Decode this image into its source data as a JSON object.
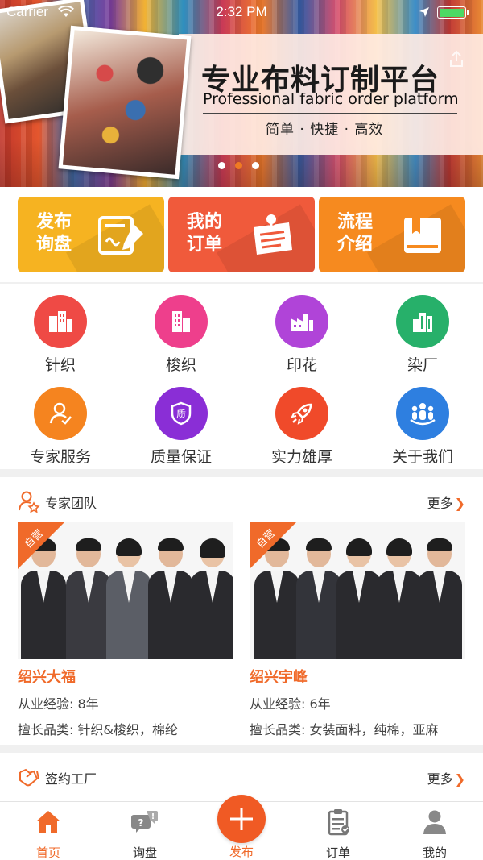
{
  "status_bar": {
    "carrier": "Carrier",
    "time": "2:32 PM",
    "battery_level": 1.0
  },
  "banner": {
    "title": "专业布料订制平台",
    "subtitle_en": "Professional fabric order platform",
    "tagline": "简单 · 快捷 · 高效",
    "slide_count": 3,
    "active_slide": 1
  },
  "quick_actions": [
    {
      "line1": "发布",
      "line2": "询盘",
      "icon": "edit-form-icon",
      "color": "#f6b321"
    },
    {
      "line1": "我的",
      "line2": "订单",
      "icon": "pinned-note-icon",
      "color": "#f05a3b"
    },
    {
      "line1": "流程",
      "line2": "介绍",
      "icon": "book-icon",
      "color": "#f68a1f"
    }
  ],
  "categories": [
    {
      "label": "针织",
      "icon": "buildings-icon",
      "color": "#ef4a45"
    },
    {
      "label": "梭织",
      "icon": "office-building-icon",
      "color": "#ee3f8c"
    },
    {
      "label": "印花",
      "icon": "factory-icon",
      "color": "#b044d8"
    },
    {
      "label": "染厂",
      "icon": "city-icon",
      "color": "#27b06a"
    },
    {
      "label": "专家服务",
      "icon": "user-check-icon",
      "color": "#f5841f"
    },
    {
      "label": "质量保证",
      "icon": "quality-icon",
      "color": "#8a2ed6"
    },
    {
      "label": "实力雄厚",
      "icon": "rocket-icon",
      "color": "#f04a2a"
    },
    {
      "label": "关于我们",
      "icon": "team-icon",
      "color": "#2e7fe0"
    }
  ],
  "expert_team": {
    "title": "专家团队",
    "more": "更多",
    "experts": [
      {
        "badge": "自营",
        "name": "绍兴大福",
        "experience_label": "从业经验:",
        "experience": "8年",
        "category_label": "擅长品类:",
        "categories": "针织&梭织，棉纶"
      },
      {
        "badge": "自营",
        "name": "绍兴宇峰",
        "experience_label": "从业经验:",
        "experience": "6年",
        "category_label": "擅长品类:",
        "categories": "女装面料，纯棉，亚麻"
      }
    ]
  },
  "signed_factory": {
    "title": "签约工厂",
    "more": "更多"
  },
  "tab_bar": {
    "tabs": [
      {
        "label": "首页",
        "icon": "home-icon",
        "active": true
      },
      {
        "label": "询盘",
        "icon": "inquiry-bubble-icon",
        "active": false
      },
      {
        "label": "发布",
        "icon": "plus-icon",
        "active": false
      },
      {
        "label": "订单",
        "icon": "clipboard-icon",
        "active": false
      },
      {
        "label": "我的",
        "icon": "profile-icon",
        "active": false
      }
    ]
  },
  "colors": {
    "accent": "#f06a2a",
    "fab": "#f05a24"
  }
}
